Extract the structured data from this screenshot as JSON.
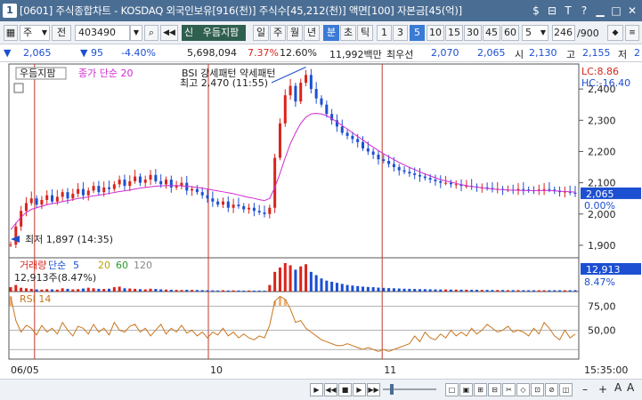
{
  "window": {
    "title": "[0601] 주식종합차트 - KOSDAQ 외국인보유[916(천)] 주식수[45,212(천)] 액면[100] 자본금[45(억)]",
    "badge": "1",
    "buttons": [
      "$",
      "⊟",
      "T",
      "?",
      "▁",
      "□",
      "✕"
    ]
  },
  "toolbar": {
    "period_field": "주",
    "compare_label": "전",
    "code": "403490",
    "stock_name": "우듬지팜",
    "credit_badge": "신",
    "period_tabs": [
      "일",
      "주",
      "월",
      "년",
      "분",
      "초",
      "틱"
    ],
    "active_period": "분",
    "minute_options": [
      "1",
      "3",
      "5",
      "10",
      "15",
      "30",
      "45",
      "60"
    ],
    "active_minute": "5",
    "interval_select": "5",
    "count_display": "246",
    "count_total": "/900"
  },
  "quote": {
    "price": "2,065",
    "change": "95",
    "change_pct": "-4.40%",
    "volume": "5,698,094",
    "turnover_pct": "7.37%",
    "ratio_pct": "12.60%",
    "amount": "11,992백만",
    "best_label": "최우선",
    "ask": "2,070",
    "bid": "2,065",
    "open_label": "시",
    "open": "2,130",
    "high_label": "고",
    "high": "2,155",
    "low_label": "저",
    "low_partial": "2"
  },
  "chart_data": [
    {
      "type": "candlestick",
      "legend": [
        "우듬지팜",
        "종가 단순 20",
        "BSI 강세패턴 약세패턴"
      ],
      "annotations": {
        "high": "최고 2,470 (11:55)",
        "low": "최저 1,897 (14:35)"
      },
      "y_ticks": [
        "2,400",
        "2,300",
        "2,200",
        "2,100",
        "2,000",
        "1,900"
      ],
      "ylim": [
        1860,
        2480
      ],
      "current_price_tag": "2,065",
      "current_pct_tag": "0.00%",
      "lc_label": "LC:8.86",
      "hc_label": "HC:-16.40",
      "close": [
        1902,
        1960,
        2010,
        2035,
        2050,
        2030,
        2045,
        2060,
        2040,
        2055,
        2070,
        2050,
        2065,
        2080,
        2060,
        2075,
        2090,
        2070,
        2085,
        2080,
        2095,
        2110,
        2090,
        2105,
        2120,
        2100,
        2110,
        2125,
        2105,
        2095,
        2110,
        2085,
        2090,
        2100,
        2075,
        2080,
        2070,
        2060,
        2050,
        2040,
        2030,
        2040,
        2020,
        2030,
        2025,
        2015,
        2020,
        2010,
        2005,
        2000,
        2020,
        2180,
        2290,
        2380,
        2410,
        2360,
        2420,
        2445,
        2400,
        2370,
        2350,
        2320,
        2300,
        2280,
        2260,
        2250,
        2240,
        2230,
        2210,
        2200,
        2190,
        2175,
        2170,
        2160,
        2150,
        2140,
        2135,
        2130,
        2125,
        2120,
        2115,
        2110,
        2105,
        2100,
        2100,
        2095,
        2095,
        2090,
        2090,
        2088,
        2085,
        2085,
        2083,
        2080,
        2080,
        2078,
        2078,
        2075,
        2080,
        2078,
        2076,
        2075,
        2078,
        2080,
        2078,
        2075,
        2070,
        2072,
        2068,
        2065
      ],
      "ma20": [
        1950,
        1970,
        1990,
        2005,
        2015,
        2020,
        2025,
        2030,
        2033,
        2036,
        2040,
        2043,
        2046,
        2050,
        2052,
        2055,
        2058,
        2060,
        2063,
        2066,
        2069,
        2072,
        2074,
        2077,
        2080,
        2083,
        2085,
        2087,
        2089,
        2090,
        2091,
        2091,
        2091,
        2090,
        2089,
        2087,
        2085,
        2083,
        2080,
        2077,
        2074,
        2071,
        2068,
        2065,
        2061,
        2057,
        2053,
        2050,
        2046,
        2043,
        2050,
        2085,
        2130,
        2180,
        2225,
        2260,
        2290,
        2310,
        2320,
        2322,
        2320,
        2315,
        2305,
        2295,
        2283,
        2272,
        2260,
        2248,
        2237,
        2225,
        2214,
        2203,
        2193,
        2183,
        2174,
        2165,
        2157,
        2149,
        2142,
        2135,
        2128,
        2122,
        2116,
        2110,
        2106,
        2102,
        2098,
        2094,
        2091,
        2088,
        2086,
        2084,
        2082,
        2080,
        2079,
        2078,
        2077,
        2076,
        2076,
        2075,
        2075,
        2075,
        2075,
        2075,
        2075,
        2074,
        2073,
        2072,
        2071,
        2070
      ]
    },
    {
      "type": "bar",
      "legend": [
        "거래량",
        "단순",
        "5",
        "20",
        "60",
        "120"
      ],
      "info": "12,913주(8.47%)",
      "tag_value": "12,913",
      "tag_pct": "8.47%",
      "values": [
        40,
        60,
        35,
        30,
        25,
        20,
        18,
        22,
        20,
        18,
        30,
        25,
        20,
        22,
        28,
        35,
        30,
        25,
        24,
        26,
        40,
        45,
        30,
        28,
        25,
        22,
        20,
        26,
        24,
        20,
        18,
        16,
        15,
        14,
        16,
        15,
        14,
        13,
        12,
        11,
        10,
        12,
        10,
        11,
        10,
        9,
        10,
        9,
        9,
        8,
        60,
        180,
        220,
        260,
        240,
        200,
        230,
        250,
        180,
        150,
        120,
        100,
        90,
        80,
        70,
        60,
        55,
        50,
        45,
        42,
        40,
        36,
        34,
        32,
        30,
        28,
        26,
        25,
        24,
        22,
        22,
        21,
        20,
        19,
        19,
        18,
        18,
        17,
        17,
        16,
        16,
        15,
        15,
        14,
        14,
        14,
        13,
        13,
        13,
        12,
        12,
        12,
        12,
        12,
        12,
        12,
        12,
        12,
        12,
        13
      ]
    },
    {
      "type": "line",
      "legend": [
        "RSI",
        "14"
      ],
      "y_ticks": [
        "75,00",
        "50,00"
      ],
      "ylim": [
        20,
        90
      ],
      "values": [
        85,
        60,
        48,
        55,
        52,
        45,
        55,
        48,
        52,
        46,
        58,
        50,
        44,
        54,
        52,
        46,
        56,
        48,
        52,
        45,
        58,
        50,
        48,
        54,
        56,
        48,
        52,
        44,
        50,
        56,
        46,
        52,
        48,
        55,
        47,
        50,
        44,
        48,
        42,
        48,
        45,
        52,
        44,
        48,
        42,
        46,
        42,
        40,
        44,
        42,
        55,
        80,
        85,
        82,
        72,
        58,
        60,
        52,
        48,
        44,
        40,
        38,
        36,
        34,
        34,
        36,
        34,
        32,
        30,
        32,
        30,
        28,
        30,
        28,
        30,
        32,
        34,
        36,
        44,
        38,
        48,
        42,
        40,
        46,
        42,
        50,
        44,
        48,
        44,
        52,
        46,
        50,
        56,
        52,
        48,
        50,
        54,
        48,
        50,
        48,
        44,
        52,
        46,
        58,
        52,
        44,
        40,
        50,
        42,
        46
      ]
    },
    {
      "type": "time_axis",
      "labels": [
        "06/05",
        "10",
        "11"
      ],
      "end_label": "15:35:00"
    }
  ],
  "colors": {
    "up": "#d9241c",
    "down": "#1c4fd1",
    "ma": "#d22ad2",
    "rsi": "#c8751e",
    "divider": "#c03a2b"
  }
}
